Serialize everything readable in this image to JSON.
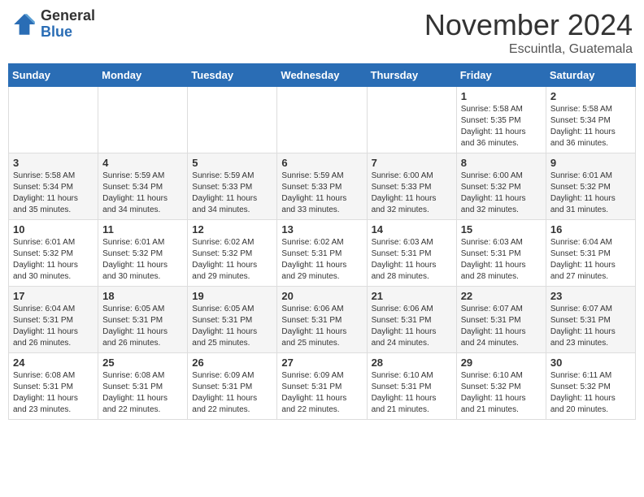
{
  "header": {
    "logo_general": "General",
    "logo_blue": "Blue",
    "month_title": "November 2024",
    "location": "Escuintla, Guatemala"
  },
  "calendar": {
    "weekdays": [
      "Sunday",
      "Monday",
      "Tuesday",
      "Wednesday",
      "Thursday",
      "Friday",
      "Saturday"
    ],
    "weeks": [
      [
        {
          "day": "",
          "info": ""
        },
        {
          "day": "",
          "info": ""
        },
        {
          "day": "",
          "info": ""
        },
        {
          "day": "",
          "info": ""
        },
        {
          "day": "",
          "info": ""
        },
        {
          "day": "1",
          "info": "Sunrise: 5:58 AM\nSunset: 5:35 PM\nDaylight: 11 hours\nand 36 minutes."
        },
        {
          "day": "2",
          "info": "Sunrise: 5:58 AM\nSunset: 5:34 PM\nDaylight: 11 hours\nand 36 minutes."
        }
      ],
      [
        {
          "day": "3",
          "info": "Sunrise: 5:58 AM\nSunset: 5:34 PM\nDaylight: 11 hours\nand 35 minutes."
        },
        {
          "day": "4",
          "info": "Sunrise: 5:59 AM\nSunset: 5:34 PM\nDaylight: 11 hours\nand 34 minutes."
        },
        {
          "day": "5",
          "info": "Sunrise: 5:59 AM\nSunset: 5:33 PM\nDaylight: 11 hours\nand 34 minutes."
        },
        {
          "day": "6",
          "info": "Sunrise: 5:59 AM\nSunset: 5:33 PM\nDaylight: 11 hours\nand 33 minutes."
        },
        {
          "day": "7",
          "info": "Sunrise: 6:00 AM\nSunset: 5:33 PM\nDaylight: 11 hours\nand 32 minutes."
        },
        {
          "day": "8",
          "info": "Sunrise: 6:00 AM\nSunset: 5:32 PM\nDaylight: 11 hours\nand 32 minutes."
        },
        {
          "day": "9",
          "info": "Sunrise: 6:01 AM\nSunset: 5:32 PM\nDaylight: 11 hours\nand 31 minutes."
        }
      ],
      [
        {
          "day": "10",
          "info": "Sunrise: 6:01 AM\nSunset: 5:32 PM\nDaylight: 11 hours\nand 30 minutes."
        },
        {
          "day": "11",
          "info": "Sunrise: 6:01 AM\nSunset: 5:32 PM\nDaylight: 11 hours\nand 30 minutes."
        },
        {
          "day": "12",
          "info": "Sunrise: 6:02 AM\nSunset: 5:32 PM\nDaylight: 11 hours\nand 29 minutes."
        },
        {
          "day": "13",
          "info": "Sunrise: 6:02 AM\nSunset: 5:31 PM\nDaylight: 11 hours\nand 29 minutes."
        },
        {
          "day": "14",
          "info": "Sunrise: 6:03 AM\nSunset: 5:31 PM\nDaylight: 11 hours\nand 28 minutes."
        },
        {
          "day": "15",
          "info": "Sunrise: 6:03 AM\nSunset: 5:31 PM\nDaylight: 11 hours\nand 28 minutes."
        },
        {
          "day": "16",
          "info": "Sunrise: 6:04 AM\nSunset: 5:31 PM\nDaylight: 11 hours\nand 27 minutes."
        }
      ],
      [
        {
          "day": "17",
          "info": "Sunrise: 6:04 AM\nSunset: 5:31 PM\nDaylight: 11 hours\nand 26 minutes."
        },
        {
          "day": "18",
          "info": "Sunrise: 6:05 AM\nSunset: 5:31 PM\nDaylight: 11 hours\nand 26 minutes."
        },
        {
          "day": "19",
          "info": "Sunrise: 6:05 AM\nSunset: 5:31 PM\nDaylight: 11 hours\nand 25 minutes."
        },
        {
          "day": "20",
          "info": "Sunrise: 6:06 AM\nSunset: 5:31 PM\nDaylight: 11 hours\nand 25 minutes."
        },
        {
          "day": "21",
          "info": "Sunrise: 6:06 AM\nSunset: 5:31 PM\nDaylight: 11 hours\nand 24 minutes."
        },
        {
          "day": "22",
          "info": "Sunrise: 6:07 AM\nSunset: 5:31 PM\nDaylight: 11 hours\nand 24 minutes."
        },
        {
          "day": "23",
          "info": "Sunrise: 6:07 AM\nSunset: 5:31 PM\nDaylight: 11 hours\nand 23 minutes."
        }
      ],
      [
        {
          "day": "24",
          "info": "Sunrise: 6:08 AM\nSunset: 5:31 PM\nDaylight: 11 hours\nand 23 minutes."
        },
        {
          "day": "25",
          "info": "Sunrise: 6:08 AM\nSunset: 5:31 PM\nDaylight: 11 hours\nand 22 minutes."
        },
        {
          "day": "26",
          "info": "Sunrise: 6:09 AM\nSunset: 5:31 PM\nDaylight: 11 hours\nand 22 minutes."
        },
        {
          "day": "27",
          "info": "Sunrise: 6:09 AM\nSunset: 5:31 PM\nDaylight: 11 hours\nand 22 minutes."
        },
        {
          "day": "28",
          "info": "Sunrise: 6:10 AM\nSunset: 5:31 PM\nDaylight: 11 hours\nand 21 minutes."
        },
        {
          "day": "29",
          "info": "Sunrise: 6:10 AM\nSunset: 5:32 PM\nDaylight: 11 hours\nand 21 minutes."
        },
        {
          "day": "30",
          "info": "Sunrise: 6:11 AM\nSunset: 5:32 PM\nDaylight: 11 hours\nand 20 minutes."
        }
      ]
    ]
  }
}
